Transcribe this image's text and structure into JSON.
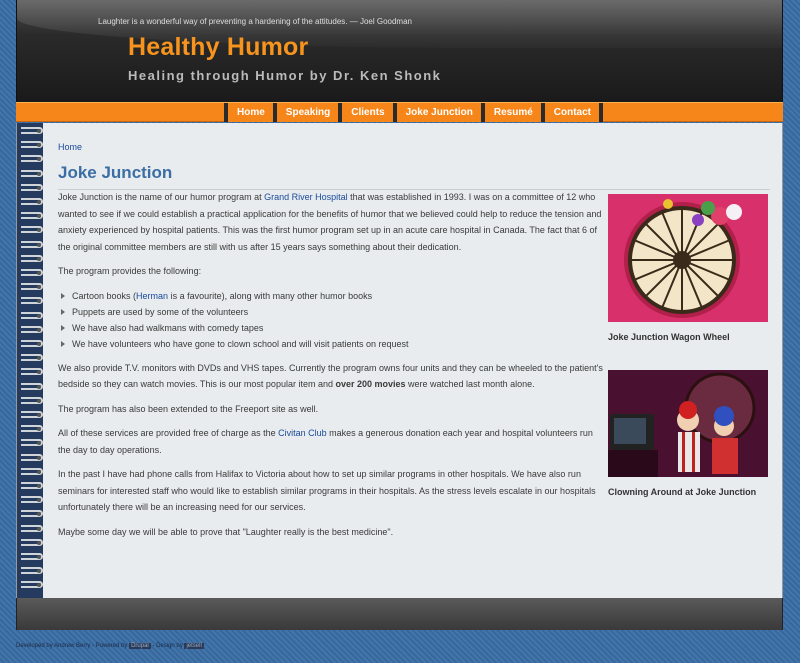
{
  "header": {
    "quote": "Laughter is a wonderful way of preventing a hardening of the attitudes.  — Joel Goodman",
    "title": "Healthy Humor",
    "subtitle": "Healing through Humor by Dr. Ken Shonk"
  },
  "nav": {
    "items": [
      "Home",
      "Speaking",
      "Clients",
      "Joke Junction",
      "Resumé",
      "Contact"
    ]
  },
  "breadcrumb": "Home",
  "page_title": "Joke Junction",
  "body": {
    "p1_a": "Joke Junction is the name of our humor program at ",
    "p1_link": "Grand River Hospital",
    "p1_b": " that was established in 1993. I was on a committee of 12 who wanted to see if we could establish a practical application for the benefits of humor that we believed could help to reduce the tension and anxiety experienced by hospital patients. This was the first humor program set up in an acute care hospital in Canada. The fact that 6 of the original committee members are still with us after 15 years says something about their dedication.",
    "p2": "The program provides the following:",
    "bullet1_a": "Cartoon books (",
    "bullet1_link": "Herman",
    "bullet1_b": " is a favourite), along with many other humor books",
    "bullet2": "Puppets are used by some of the volunteers",
    "bullet3": "We have also had walkmans with comedy tapes",
    "bullet4": "We have volunteers who have gone to clown school and will visit patients on request",
    "p3_a": "We also provide T.V. monitors with DVDs and VHS tapes. Currently the program owns four units and they can be wheeled to the patient's bedside so they can watch movies. This is our most popular item and ",
    "p3_bold": "over 200 movies",
    "p3_b": " were watched last month alone.",
    "p4": "The program has also been extended to the Freeport site as well.",
    "p5_a": "All of these services are provided free of charge as the ",
    "p5_link": "Civitan Club",
    "p5_b": " makes a generous donation each year and hospital volunteers run the day to day operations.",
    "p6": "In the past I have had phone calls from Halifax to Victoria about how to set up similar programs in other hospitals. We have also run seminars for interested staff who would like to establish similar programs in their hospitals. As the stress levels escalate in our hospitals unfortunately there will be an increasing need for our services.",
    "p7": "Maybe some day we will be able to prove that \"Laughter really is the best medicine\"."
  },
  "sidebar": {
    "caption1": "Joke Junction Wagon Wheel",
    "caption2": "Clowning Around at Joke Junction"
  },
  "footer": {
    "text_a": "Developed by Andrew Berry - Powered by ",
    "link1": "Drupal",
    "text_b": " - Design by ",
    "link2": "jetsell"
  },
  "colors": {
    "accent_orange": "#f7941d",
    "nav_orange": "#f7861a",
    "link_blue": "#1a4a9a",
    "title_blue": "#3a6ea5"
  }
}
